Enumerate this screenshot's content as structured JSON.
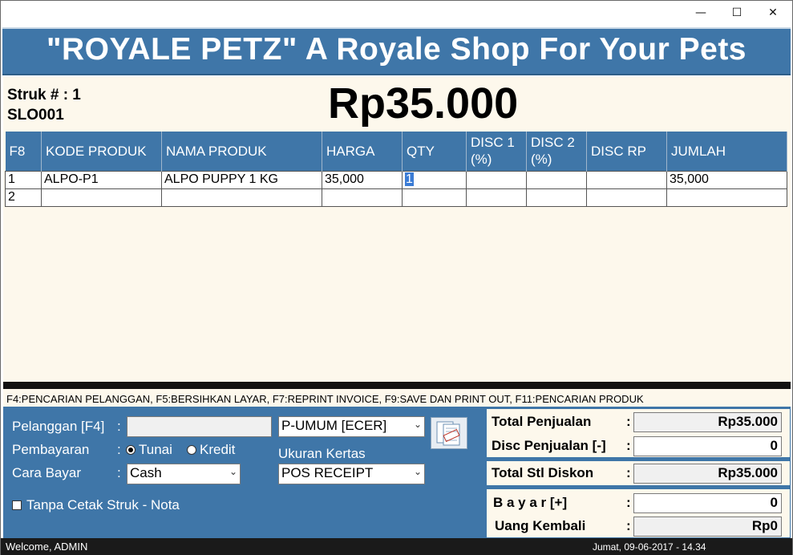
{
  "window": {
    "controls": {
      "minimize": "—",
      "maximize": "☐",
      "close": "✕"
    }
  },
  "banner": {
    "title": "\"ROYALE PETZ\" A Royale Shop For Your Pets"
  },
  "header": {
    "struk": "Struk # : 1",
    "code": "SLO001",
    "total": "Rp35.000"
  },
  "grid": {
    "columns": [
      "F8",
      "KODE PRODUK",
      "NAMA PRODUK",
      "HARGA",
      "QTY",
      "DISC 1 (%)",
      "DISC 2 (%)",
      "DISC RP",
      "JUMLAH"
    ],
    "rows": [
      {
        "no": "1",
        "kode": "ALPO-P1",
        "nama": "ALPO PUPPY 1 KG",
        "harga": "35,000",
        "qty": "1",
        "disc1": "",
        "disc2": "",
        "discrp": "",
        "jumlah": "35,000"
      },
      {
        "no": "2",
        "kode": "",
        "nama": "",
        "harga": "",
        "qty": "",
        "disc1": "",
        "disc2": "",
        "discrp": "",
        "jumlah": ""
      }
    ]
  },
  "hints": "F4:PENCARIAN PELANGGAN, F5:BERSIHKAN LAYAR, F7:REPRINT INVOICE, F9:SAVE DAN PRINT OUT, F11:PENCARIAN PRODUK",
  "form": {
    "pelanggan_label": "Pelanggan [F4]",
    "pelanggan_value": "",
    "customer_type": "P-UMUM [ECER]",
    "pembayaran_label": "Pembayaran",
    "tunai": "Tunai",
    "kredit": "Kredit",
    "cara_bayar_label": "Cara Bayar",
    "cara_bayar_value": "Cash",
    "ukuran_label": "Ukuran Kertas",
    "ukuran_value": "POS RECEIPT",
    "tanpa_cetak": "Tanpa Cetak Struk - Nota",
    "colon": ":"
  },
  "summary": {
    "total_penjualan_label": "Total Penjualan",
    "total_penjualan": "Rp35.000",
    "disc_penjualan_label": "Disc Penjualan [-]",
    "disc_penjualan": "0",
    "total_stl_label": "Total Stl Diskon",
    "total_stl": "Rp35.000",
    "bayar_label": "B a y a r  [+]",
    "bayar": "0",
    "kembali_label": "Uang Kembali",
    "kembali": "Rp0",
    "colon": ":"
  },
  "status": {
    "welcome": "Welcome, ADMIN",
    "datetime": "Jumat, 09-06-2017 - 14.34"
  },
  "colors": {
    "accent": "#3f76a8",
    "panel": "#fdf8ec"
  }
}
